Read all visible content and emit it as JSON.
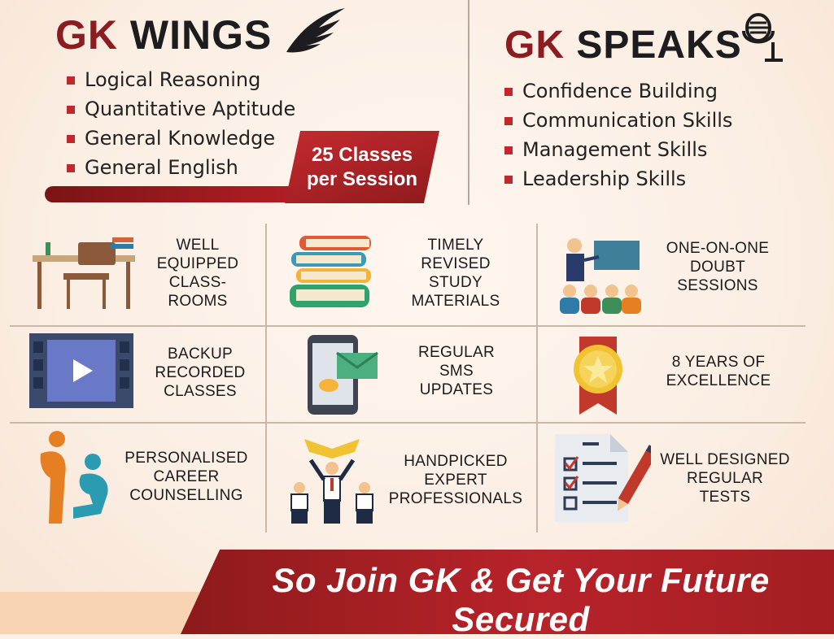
{
  "wings": {
    "brand_prefix": "GK",
    "brand_name": "WINGS",
    "subjects": [
      "Logical Reasoning",
      "Quantitative Aptitude",
      "General Knowledge",
      "General English"
    ],
    "classes_line1": "25 Classes",
    "classes_line2": "per Session"
  },
  "speaks": {
    "brand_prefix": "GK",
    "brand_name": "SPEAKS",
    "skills": [
      "Confidence Building",
      "Communication Skills",
      "Management Skills",
      "Leadership Skills"
    ]
  },
  "features": [
    {
      "icon": "classroom-desk-icon",
      "lines": [
        "WELL",
        "EQUIPPED",
        "CLASS-",
        "ROOMS"
      ]
    },
    {
      "icon": "book-stack-icon",
      "lines": [
        "TIMELY",
        "REVISED",
        "STUDY",
        "MATERIALS"
      ]
    },
    {
      "icon": "teacher-students-icon",
      "lines": [
        "ONE-ON-ONE",
        "DOUBT",
        "SESSIONS"
      ]
    },
    {
      "icon": "video-player-icon",
      "lines": [
        "BACKUP",
        "RECORDED",
        "CLASSES"
      ]
    },
    {
      "icon": "phone-sms-icon",
      "lines": [
        "REGULAR",
        "SMS",
        "UPDATES"
      ]
    },
    {
      "icon": "medal-icon",
      "lines": [
        "8 YEARS OF",
        "EXCELLENCE"
      ]
    },
    {
      "icon": "counselling-people-icon",
      "lines": [
        "PERSONALISED",
        "CAREER",
        "COUNSELLING"
      ]
    },
    {
      "icon": "experts-team-icon",
      "lines": [
        "HANDPICKED",
        "EXPERT",
        "PROFESSIONALS"
      ]
    },
    {
      "icon": "checklist-pencil-icon",
      "lines": [
        "WELL DESIGNED",
        "REGULAR",
        "TESTS"
      ]
    }
  ],
  "tagline": "So Join GK & Get Your Future Secured",
  "colors": {
    "brand_red": "#8b1d20",
    "accent_red": "#c0282b",
    "background": "#fdf0e6"
  }
}
